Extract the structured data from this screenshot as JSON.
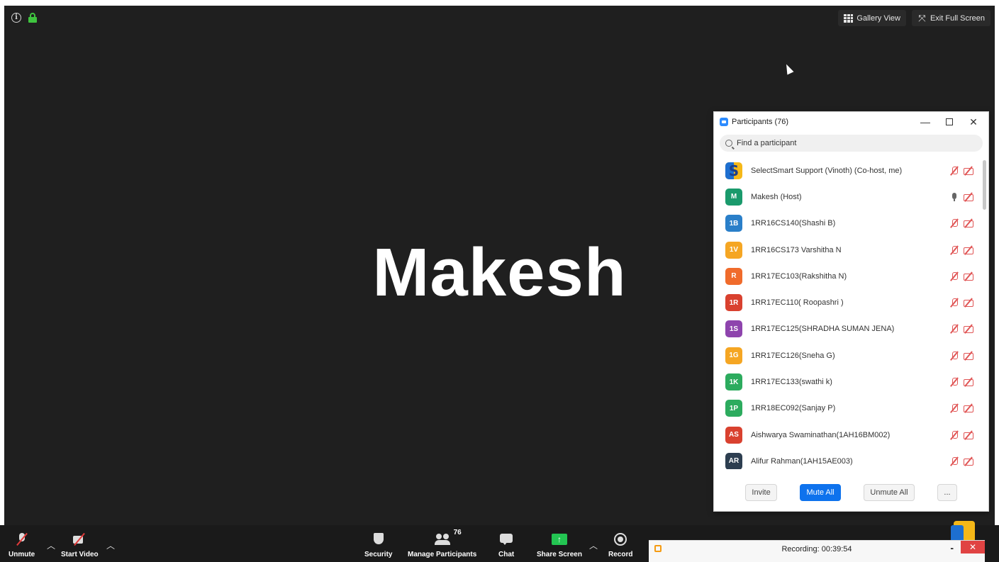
{
  "top_bar": {
    "gallery_view_label": "Gallery View",
    "exit_full_screen_label": "Exit Full Screen"
  },
  "speaker": {
    "name": "Makesh"
  },
  "participants_panel": {
    "title": "Participants (76)",
    "search_placeholder": "Find a participant",
    "participants": [
      {
        "initials": "",
        "name": "SelectSmart Support (Vinoth) (Co-host, me)",
        "color": "#f5b818",
        "avatar": "logo",
        "mic": "muted",
        "video": "off"
      },
      {
        "initials": "M",
        "name": "Makesh (Host)",
        "color": "#1a9a6c",
        "avatar": "initials",
        "mic": "on",
        "video": "off"
      },
      {
        "initials": "1B",
        "name": "1RR16CS140(Shashi B)",
        "color": "#2a7fc9",
        "avatar": "initials",
        "mic": "muted",
        "video": "off"
      },
      {
        "initials": "1V",
        "name": "1RR16CS173 Varshitha N",
        "color": "#f5a623",
        "avatar": "initials",
        "mic": "muted",
        "video": "off"
      },
      {
        "initials": "R",
        "name": "1RR17EC103(Rakshitha N)",
        "color": "#f06b2b",
        "avatar": "initials",
        "mic": "muted",
        "video": "off"
      },
      {
        "initials": "1R",
        "name": "1RR17EC110( Roopashri )",
        "color": "#d9412f",
        "avatar": "initials",
        "mic": "muted",
        "video": "off"
      },
      {
        "initials": "1S",
        "name": "1RR17EC125(SHRADHA SUMAN JENA)",
        "color": "#8e44ad",
        "avatar": "initials",
        "mic": "muted",
        "video": "off"
      },
      {
        "initials": "1G",
        "name": "1RR17EC126(Sneha G)",
        "color": "#f5a623",
        "avatar": "initials",
        "mic": "muted",
        "video": "off"
      },
      {
        "initials": "1K",
        "name": "1RR17EC133(swathi k)",
        "color": "#2cab5e",
        "avatar": "initials",
        "mic": "muted",
        "video": "off"
      },
      {
        "initials": "1P",
        "name": "1RR18EC092(Sanjay P)",
        "color": "#2cab5e",
        "avatar": "initials",
        "mic": "muted",
        "video": "off"
      },
      {
        "initials": "AS",
        "name": "Aishwarya Swaminathan(1AH16BM002)",
        "color": "#d9412f",
        "avatar": "initials",
        "mic": "muted",
        "video": "off"
      },
      {
        "initials": "AR",
        "name": "Alifur Rahman(1AH15AE003)",
        "color": "#2d3e50",
        "avatar": "initials",
        "mic": "muted",
        "video": "off"
      }
    ],
    "footer": {
      "invite_label": "Invite",
      "mute_all_label": "Mute All",
      "unmute_all_label": "Unmute All",
      "more_label": "..."
    }
  },
  "toolbar": {
    "unmute_label": "Unmute",
    "start_video_label": "Start Video",
    "security_label": "Security",
    "manage_participants_label": "Manage Participants",
    "participant_count": "76",
    "chat_label": "Chat",
    "share_screen_label": "Share Screen",
    "record_label": "Record"
  },
  "recording_bar": {
    "status_text": "Recording:  00:39:54",
    "minimize_label": "-",
    "close_label": "✕"
  }
}
